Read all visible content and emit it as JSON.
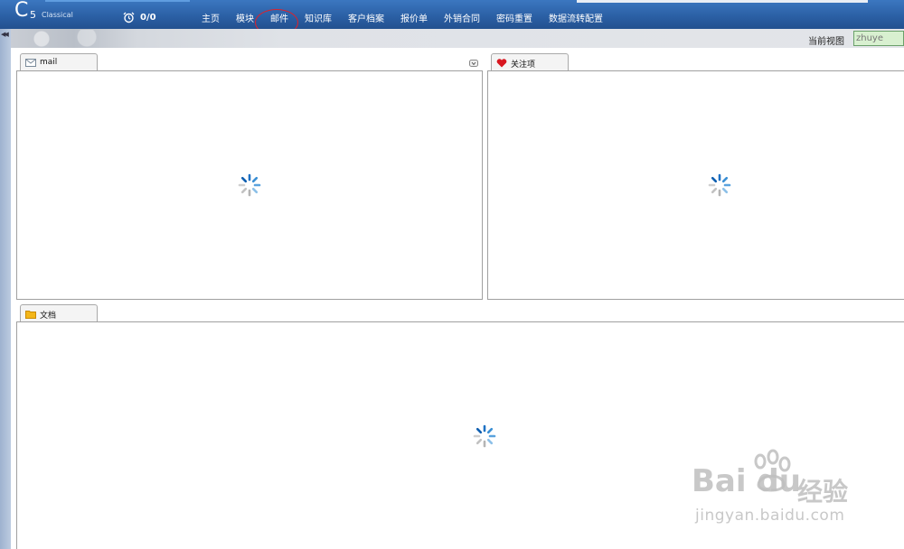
{
  "header": {
    "logo_letter": "C",
    "logo_number": "5",
    "logo_sub": "Classical",
    "counter": "0/0",
    "nav": [
      "主页",
      "模块",
      "邮件",
      "知识库",
      "客户档案",
      "报价单",
      "外销合同",
      "密码重置",
      "数据流转配置"
    ],
    "highlighted_nav": "邮件"
  },
  "toolbar": {
    "view_label": "当前视图",
    "view_value": "zhuye"
  },
  "portlets": {
    "mail": {
      "title": "mail",
      "icon": "envelope-icon"
    },
    "follow": {
      "title": "关注项",
      "icon": "heart-icon"
    },
    "docs": {
      "title": "文档",
      "icon": "folder-icon"
    }
  },
  "colors": {
    "nav_bar": "#2a5ea3",
    "annotation_circle": "#d9232e",
    "view_input_bg": "#d8f0d0",
    "spinner": "#3a8fd4"
  },
  "watermark": {
    "logo": "Bai du",
    "cn": "经验",
    "url": "jingyan.baidu.com"
  }
}
